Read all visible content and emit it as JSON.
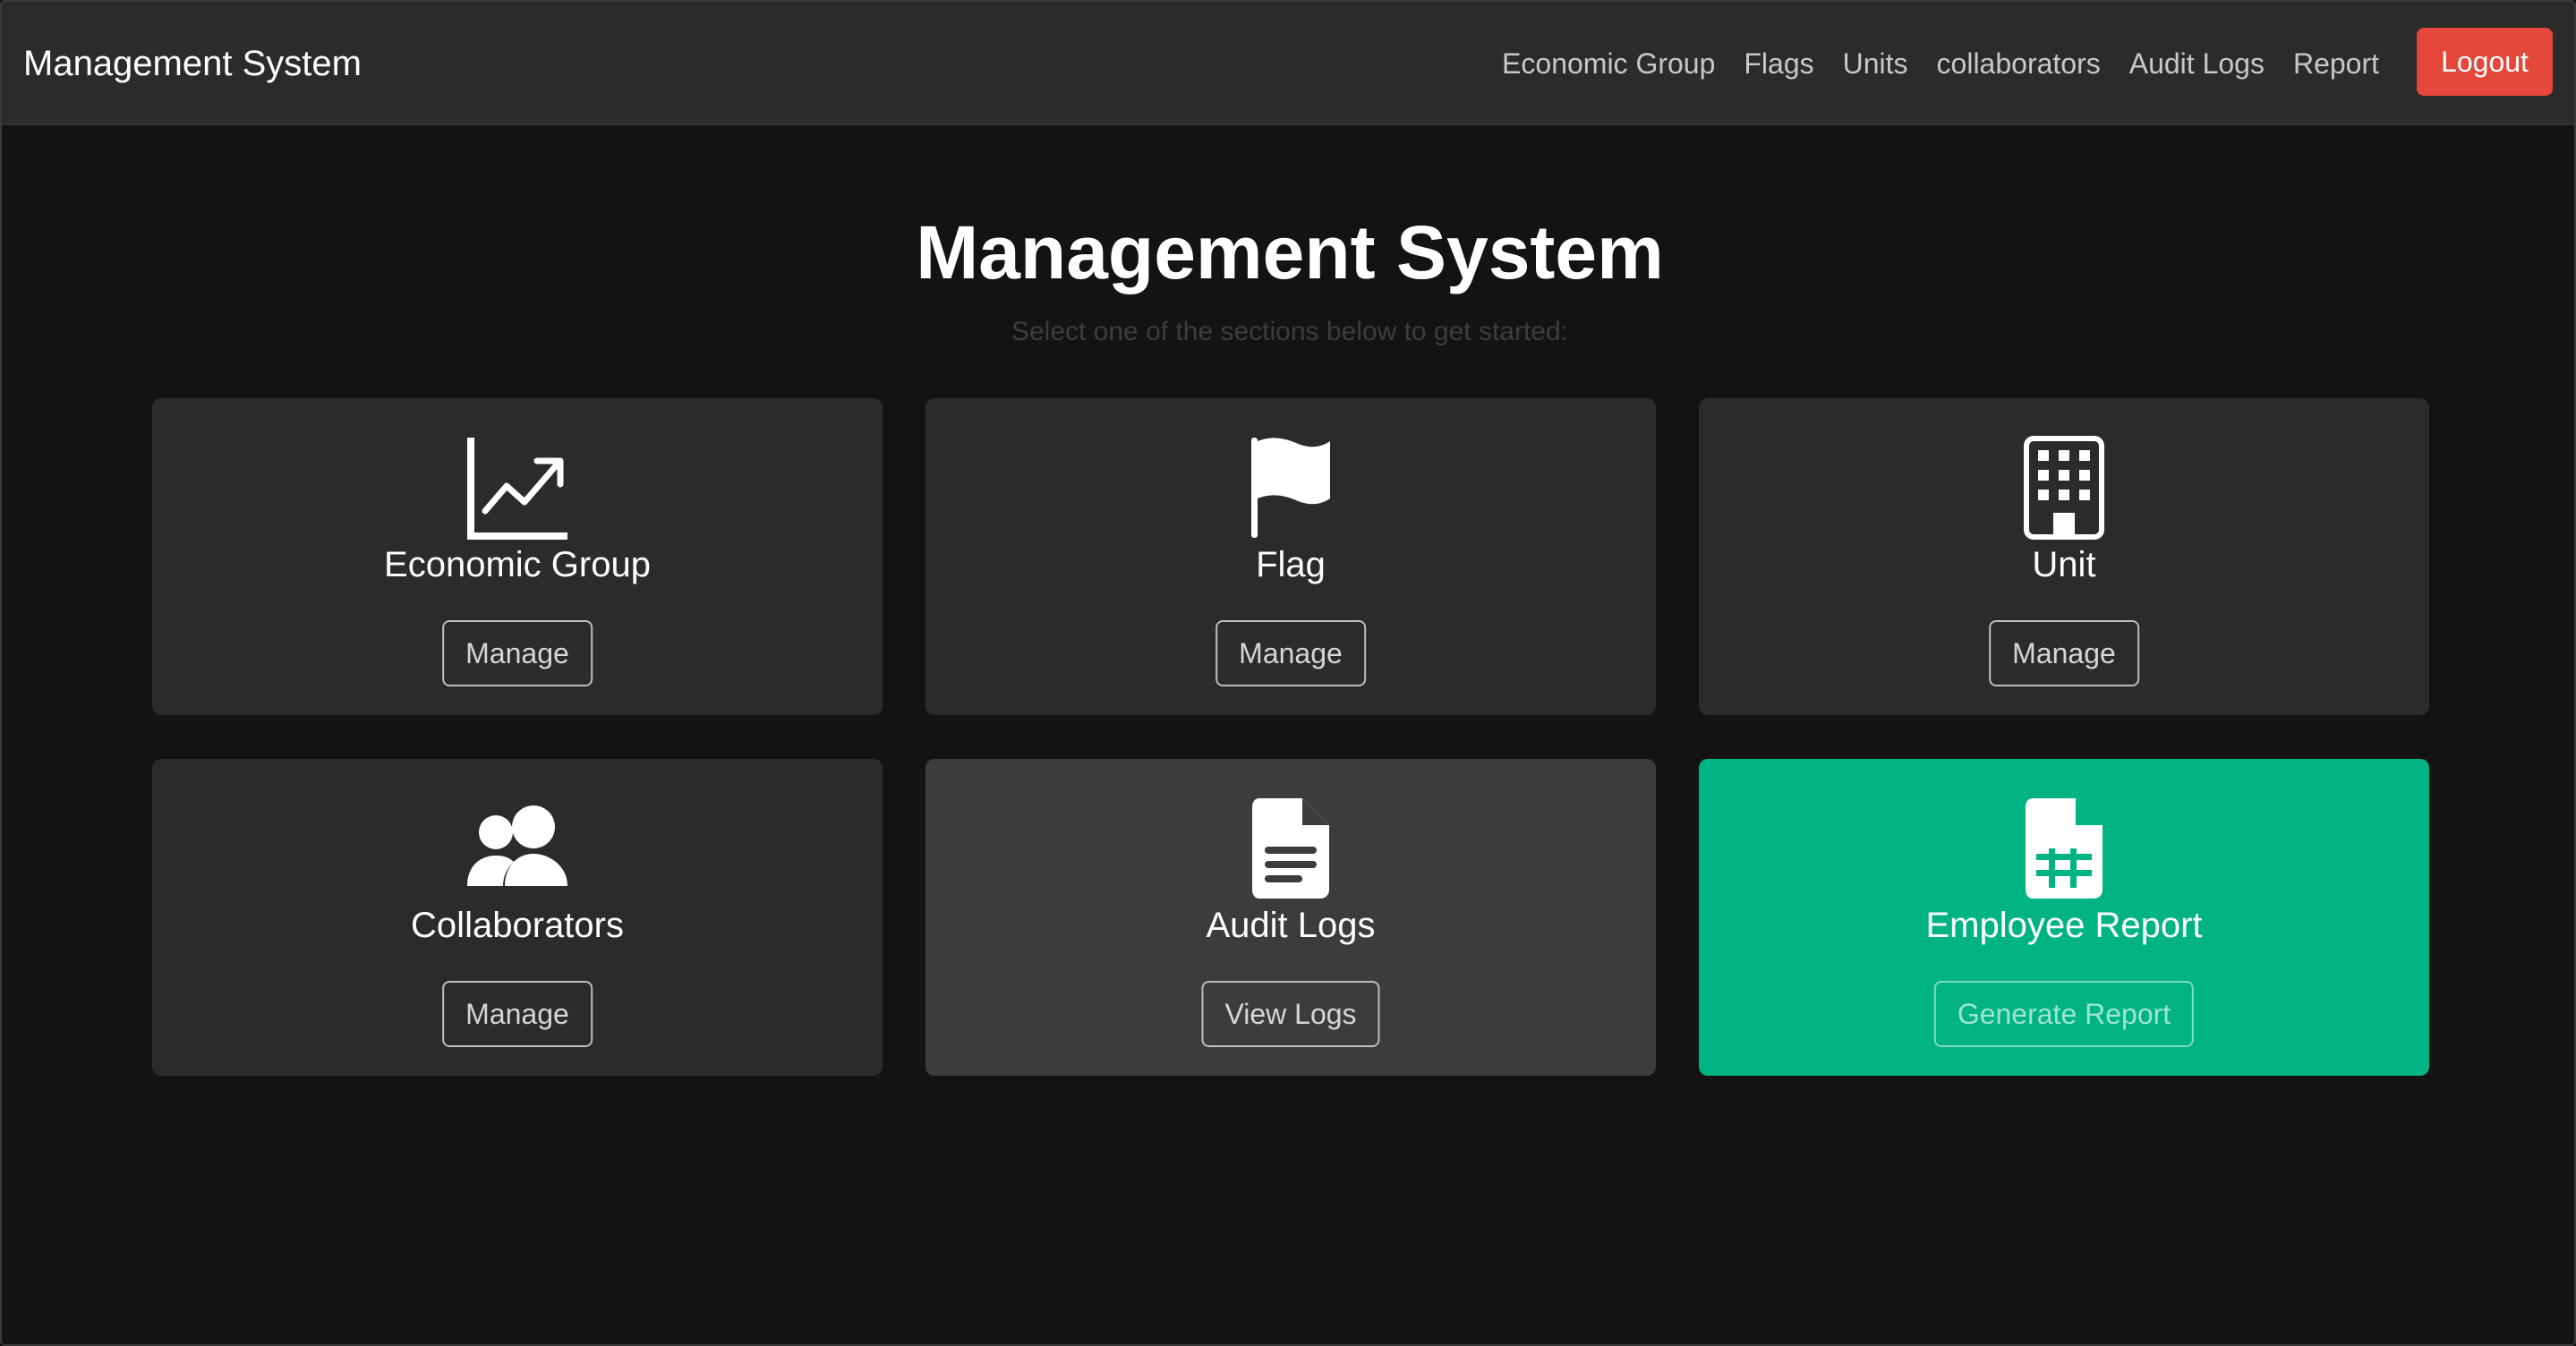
{
  "app": {
    "brand": "Management System"
  },
  "nav": {
    "links": [
      "Economic Group",
      "Flags",
      "Units",
      "collaborators",
      "Audit Logs",
      "Report"
    ],
    "logout_label": "Logout",
    "logout_color": "#e5473a"
  },
  "main": {
    "title": "Management System",
    "subtitle": "Select one of the sections below to get started:"
  },
  "cards": [
    {
      "title": "Economic Group",
      "button": "Manage",
      "icon": "chart-line-icon"
    },
    {
      "title": "Flag",
      "button": "Manage",
      "icon": "flag-icon"
    },
    {
      "title": "Unit",
      "button": "Manage",
      "icon": "building-icon"
    },
    {
      "title": "Collaborators",
      "button": "Manage",
      "icon": "users-icon"
    },
    {
      "title": "Audit Logs",
      "button": "View Logs",
      "icon": "document-icon"
    },
    {
      "title": "Employee Report",
      "button": "Generate Report",
      "icon": "spreadsheet-icon"
    }
  ],
  "colors": {
    "background": "#131313",
    "navbar": "#2b2b2b",
    "card": "#2b2b2b",
    "card_hover": "#3c3c3c",
    "accent": "#00b383"
  }
}
